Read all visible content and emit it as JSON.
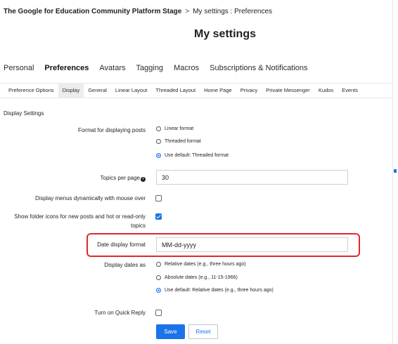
{
  "breadcrumb": {
    "root": "The Google for Education Community Platform Stage",
    "separator": ">",
    "current": "My settings : Preferences"
  },
  "page_title": "My settings",
  "top_tabs": [
    "Personal",
    "Preferences",
    "Avatars",
    "Tagging",
    "Macros",
    "Subscriptions & Notifications"
  ],
  "top_tabs_active": "Preferences",
  "sub_tabs": [
    "Preference Options",
    "Display",
    "General",
    "Linear Layout",
    "Threaded Layout",
    "Home Page",
    "Privacy",
    "Private Messenger",
    "Kudos",
    "Events"
  ],
  "sub_tabs_active": "Display",
  "section_title": "Display Settings",
  "format": {
    "label": "Format for displaying posts",
    "options": [
      "Linear format",
      "Threaded format",
      "Use default: Threaded format"
    ],
    "selected": "Use default: Threaded format"
  },
  "topics_per_page": {
    "label": "Topics per page",
    "info_icon": "info-icon",
    "value": "30"
  },
  "menus_dynamic": {
    "label": "Display menus dynamically with mouse over",
    "checked": false
  },
  "folder_icons": {
    "label": "Show folder icons for new posts and hot or read-only topics",
    "checked": true
  },
  "date_format": {
    "label": "Date display format",
    "value": "MM-dd-yyyy"
  },
  "display_dates": {
    "label": "Display dates as",
    "options": [
      "Relative dates (e.g., three hours ago)",
      "Absolute dates (e.g., 11-15-1966)",
      "Use default: Relative dates (e.g., three hours ago)"
    ],
    "selected": "Use default: Relative dates (e.g., three hours ago)"
  },
  "quick_reply": {
    "label": "Turn on Quick Reply",
    "checked": false
  },
  "buttons": {
    "save": "Save",
    "reset": "Reset"
  },
  "colors": {
    "accent": "#1a73e8",
    "highlight": "#e0282d"
  }
}
